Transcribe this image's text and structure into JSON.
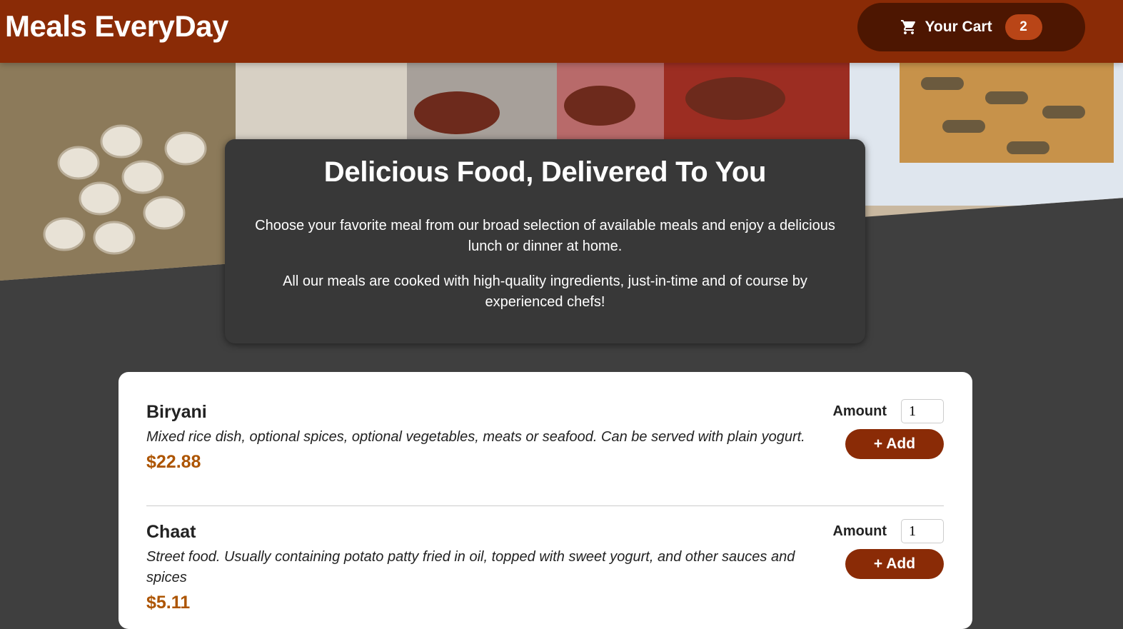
{
  "header": {
    "title": "Meals EveryDay",
    "cart": {
      "icon": "cart-icon",
      "label": "Your Cart",
      "count": "2"
    }
  },
  "summary": {
    "heading": "Delicious Food, Delivered To You",
    "paragraph1": "Choose your favorite meal from our broad selection of available meals and enjoy a delicious lunch or dinner at home.",
    "paragraph2": "All our meals are cooked with high-quality ingredients, just-in-time and of course by experienced chefs!"
  },
  "meals": [
    {
      "name": "Biryani",
      "description": "Mixed rice dish, optional spices, optional vegetables, meats or seafood. Can be served with plain yogurt.",
      "price": "$22.88",
      "amount_label": "Amount",
      "amount_value": "1",
      "add_label": "+ Add"
    },
    {
      "name": "Chaat",
      "description": "Street food. Usually containing potato patty fried in oil, topped with sweet yogurt, and other sauces and spices",
      "price": "$5.11",
      "amount_label": "Amount",
      "amount_value": "1",
      "add_label": "+ Add"
    }
  ],
  "colors": {
    "header": "#8a2b06",
    "cart_button": "#4d1601",
    "cart_badge": "#b94517",
    "price": "#ad5502",
    "page_background": "#3f3f3f"
  }
}
